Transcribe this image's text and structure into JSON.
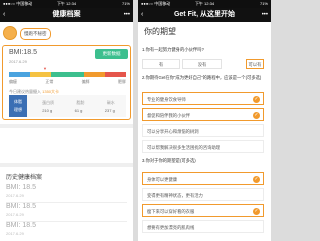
{
  "left": {
    "status": {
      "carrier": "●●●○○ 中国移动",
      "time": "下午 12:34",
      "battery": "71%"
    },
    "nav": {
      "back": "‹",
      "title": "健康档案",
      "more": "•••"
    },
    "profile": {
      "username": "慢跑不秘密"
    },
    "bmi_card": {
      "bmi": "BMI:18.5",
      "date": "2017.6.29",
      "update_button": "更新数据",
      "marker": "▼",
      "scale_colors": [
        "#4aa3df",
        "#f5c242",
        "#3cbf8e",
        "#f19a2d",
        "#e5554b"
      ],
      "scale_labels": [
        "偏瘦",
        "正常",
        "偏胖",
        "肥胖"
      ],
      "calorie_prefix": "今日建议热量摄入",
      "calorie_value": "1350大卡",
      "fat_label": "体脂",
      "fat_value": "理想",
      "stats_headers": [
        "蛋白质",
        "脂肪",
        "碳水"
      ],
      "stats_values": [
        "210 g",
        "61 g",
        "237 g"
      ]
    },
    "history": {
      "title": "历史健康档案",
      "items": [
        {
          "bmi": "BMI: 18.5",
          "date": "2017.6.29"
        },
        {
          "bmi": "BMI: 18.5",
          "date": "2017.6.29"
        },
        {
          "bmi": "BMI: 18.5",
          "date": "2017.6.29"
        }
      ]
    }
  },
  "right": {
    "status": {
      "carrier": "●●●○○ 中国移动",
      "time": "下午 12:34",
      "battery": "71%"
    },
    "nav": {
      "back": "‹",
      "title": "Get Fit, 从这里开始",
      "more": "•••"
    },
    "title": "你的期望",
    "q1": {
      "label": "1.你有一起努力健身的小伙伴吗?",
      "options": [
        "有",
        "没有",
        "可以有"
      ],
      "selected_index": 2
    },
    "q2": {
      "label": "2.你期待Get在你“成为更好自己”的路程中，应该是一个(可多选)",
      "options": [
        {
          "text": "专业的健身饮食导师",
          "selected": true
        },
        {
          "text": "督促和陪伴我的小伙伴",
          "selected": true
        },
        {
          "text": "可以分享开心和烦恼的树洞",
          "selected": false
        },
        {
          "text": "可以帮我解决很多生活困扰的咨询助理",
          "selected": false
        }
      ]
    },
    "q3": {
      "label": "3.你对于你的期望是(可多选)",
      "options": [
        {
          "text": "身体可以更健康",
          "selected": true
        },
        {
          "text": "变得更有精神状态，更有活力",
          "selected": false
        },
        {
          "text": "瘦下来可以穿好看的衣服",
          "selected": true
        },
        {
          "text": "想要有更加漂亮的肌肉线",
          "selected": false
        }
      ]
    },
    "check_glyph": "✓"
  }
}
